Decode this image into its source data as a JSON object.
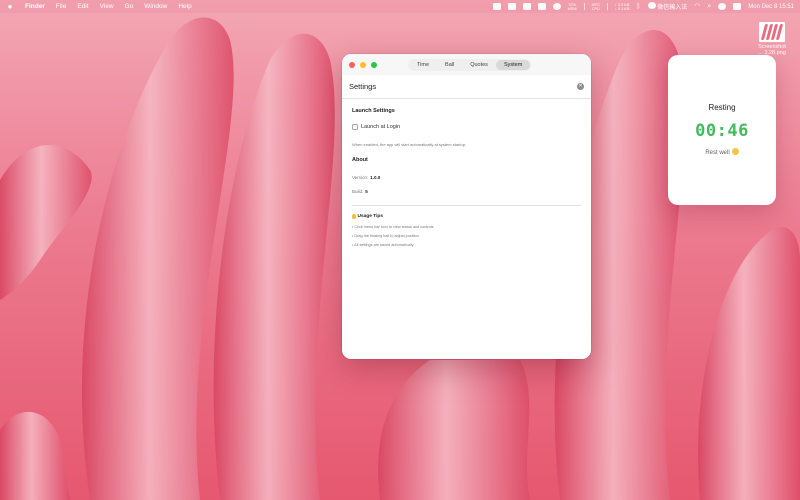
{
  "menubar": {
    "app_name": "Finder",
    "menus": [
      "File",
      "Edit",
      "View",
      "Go",
      "Window",
      "Help"
    ],
    "stats": [
      {
        "top": "72%",
        "bottom": "MEM"
      },
      {
        "top": "49°C",
        "bottom": "CPU"
      },
      {
        "top": "↑ 2.9 KB",
        "bottom": "↓ 5.1 KB"
      }
    ],
    "input_method": "微信输入法",
    "clock": "Mon Dec 8  15:51"
  },
  "desktop_icon": {
    "label_line1": "Screenshot",
    "label_line2": "... 3.28.png"
  },
  "window": {
    "tabs": [
      "Time",
      "Ball",
      "Quotes",
      "System"
    ],
    "active_tab": "System",
    "title": "Settings",
    "launch_section": "Launch Settings",
    "launch_at_login_label": "Launch at Login",
    "launch_at_login_checked": false,
    "launch_hint": "When enabled, the app will start automatically at system startup.",
    "about_section": "About",
    "version_label": "Version:",
    "version_value": "1.0.0",
    "build_label": "Build:",
    "build_value": "5",
    "tips_title": "Usage Tips",
    "tips": [
      "• Click menu bar icon to view status and controls",
      "• Drag the floating ball to adjust position",
      "• All settings are saved automatically"
    ]
  },
  "ball": {
    "status": "Resting",
    "time": "00:46",
    "note": "Rest well"
  },
  "colors": {
    "timer_green": "#46b85e",
    "wallpaper_pink": "#e8607a"
  }
}
